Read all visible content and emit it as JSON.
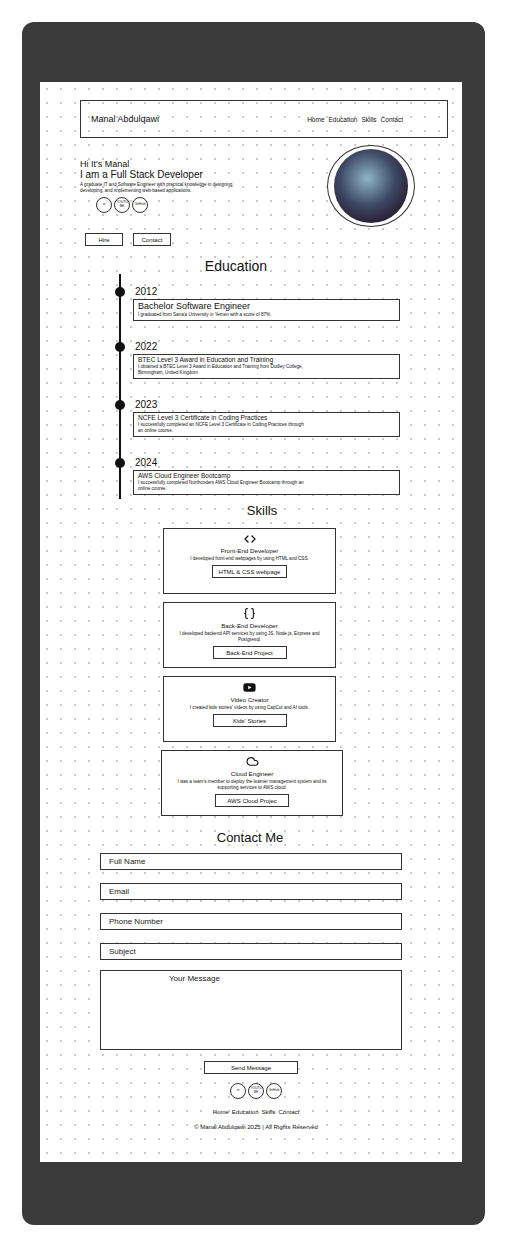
{
  "nav": {
    "brand": "Manal Abdulqawi",
    "links": [
      "Home",
      "Education",
      "Skills",
      "Contact"
    ]
  },
  "hero": {
    "greeting": "Hi It's Manal",
    "title": "I am a Full Stack Developer",
    "description": "A graduate IT and Software Engineer with practical knowledge in designing, developing, and implementing web-based applications.",
    "socials": [
      "in",
      "YOUTUBE",
      "GitHub"
    ],
    "buttons": [
      "Hire",
      "Contact"
    ]
  },
  "education": {
    "title": "Education",
    "entries": [
      {
        "year": "2012",
        "title": "Bachelor Software Engineer",
        "description": "I graduated from Sana'a University in Yemen with a score of 87%."
      },
      {
        "year": "2022",
        "title": "BTEC Level 3 Award in Education and Training",
        "description": "I obtained a BTEC Level 3 Award in Education and Training from Dudley College, Birmingham, United Kingdom"
      },
      {
        "year": "2023",
        "title": "NCFE Level 3 Certificate in Coding Practices",
        "description": "I successfully completed an NCFE Level 3 Certificate in Coding Practices through an online course."
      },
      {
        "year": "2024",
        "title": "AWS Cloud Engineer Bootcamp",
        "description": "I successfully completed Northcoders AWS Cloud Engineer Bootcamp through an online course."
      }
    ]
  },
  "skills": {
    "title": "Skills",
    "cards": [
      {
        "kind": "code",
        "title": "Front-End Developer",
        "description": "I developed front-end webpages by using HTML and CSS.",
        "button": "HTML & CSS webpage"
      },
      {
        "kind": "braces",
        "title": "Back-End Developer",
        "description": "I developed backend API services by using JS, Node.js, Express and Postgresql.",
        "button": "Back-End Project"
      },
      {
        "kind": "video",
        "title": "Video Creator",
        "description": "I created kids stories' videos by using CapCut and AI tools.",
        "button": "Kids' Stories"
      },
      {
        "kind": "cloud",
        "title": "Cloud Engineer",
        "description": "I was a team's member to deploy the learner management system and its supporting services to AWS cloud.",
        "button": "AWS Cloud Projec"
      }
    ]
  },
  "contact": {
    "title": "Contact Me",
    "fields": [
      "Full Name",
      "Email",
      "Phone Number",
      "Subject"
    ],
    "message": "Your Message",
    "button": "Send Message"
  },
  "footer": {
    "socials": [
      "in",
      "YOUTUBE",
      "GitHub"
    ],
    "links": [
      "Home",
      "Education",
      "Skills",
      "Contact"
    ],
    "copyright": "© Manal Abdulqawi 2025 | All Rights Reserved"
  }
}
